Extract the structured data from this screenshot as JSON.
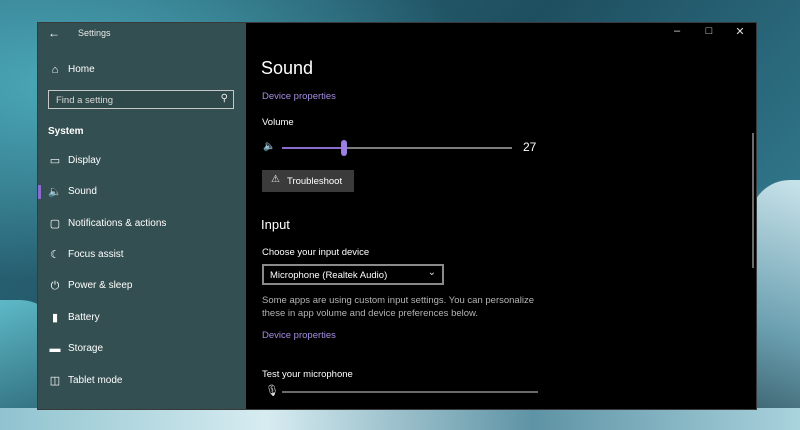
{
  "window": {
    "title": "Settings"
  },
  "sidebar": {
    "home_label": "Home",
    "search_placeholder": "Find a setting",
    "section_label": "System",
    "items": [
      {
        "label": "Display",
        "icon": "display-icon",
        "selected": false
      },
      {
        "label": "Sound",
        "icon": "speaker-icon",
        "selected": true
      },
      {
        "label": "Notifications & actions",
        "icon": "notifications-icon",
        "selected": false
      },
      {
        "label": "Focus assist",
        "icon": "moon-icon",
        "selected": false
      },
      {
        "label": "Power & sleep",
        "icon": "power-icon",
        "selected": false
      },
      {
        "label": "Battery",
        "icon": "battery-icon",
        "selected": false
      },
      {
        "label": "Storage",
        "icon": "storage-icon",
        "selected": false
      },
      {
        "label": "Tablet mode",
        "icon": "tablet-icon",
        "selected": false
      }
    ]
  },
  "main": {
    "page_title": "Sound",
    "device_properties_link": "Device properties",
    "volume_label": "Volume",
    "volume_value": "27",
    "troubleshoot_label": "Troubleshoot",
    "input_heading": "Input",
    "choose_input_label": "Choose your input device",
    "input_device": "Microphone (Realtek Audio)",
    "custom_settings_note": "Some apps are using custom input settings. You can personalize these in app volume and device preferences below.",
    "input_device_properties_link": "Device properties",
    "test_mic_label": "Test your microphone",
    "mic_level": 0
  },
  "colors": {
    "accent": "#8a6cd1",
    "link": "#a48ce0",
    "background": "#000000"
  }
}
